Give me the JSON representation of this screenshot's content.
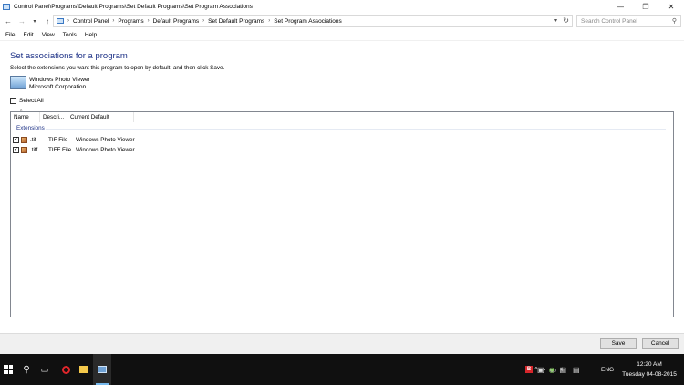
{
  "window": {
    "title": "Control Panel\\Programs\\Default Programs\\Set Default Programs\\Set Program Associations",
    "controls": {
      "minimize": "—",
      "maximize": "❐",
      "close": "✕"
    }
  },
  "address": {
    "breadcrumbs": [
      "Control Panel",
      "Programs",
      "Default Programs",
      "Set Default Programs",
      "Set Program Associations"
    ],
    "search_placeholder": "Search Control Panel"
  },
  "menu": [
    "File",
    "Edit",
    "View",
    "Tools",
    "Help"
  ],
  "main": {
    "title": "Set associations for a program",
    "instructions": "Select the extensions you want this program to open by default, and then click Save.",
    "program_name": "Windows Photo Viewer",
    "program_company": "Microsoft Corporation",
    "select_all_label": "Select All",
    "columns": [
      "Name",
      "Descri...",
      "Current Default"
    ],
    "group_label": "Extensions",
    "rows": [
      {
        "ext": ".tif",
        "desc": "TIF File",
        "current": "Windows Photo Viewer",
        "checked": true
      },
      {
        "ext": ".tiff",
        "desc": "TIFF File",
        "current": "Windows Photo Viewer",
        "checked": true
      }
    ]
  },
  "buttons": {
    "save": "Save",
    "cancel": "Cancel"
  },
  "taskbar": {
    "tray_language": "ENG",
    "clock_time": "12:20 AM",
    "clock_date": "Tuesday 04-08-2015"
  }
}
